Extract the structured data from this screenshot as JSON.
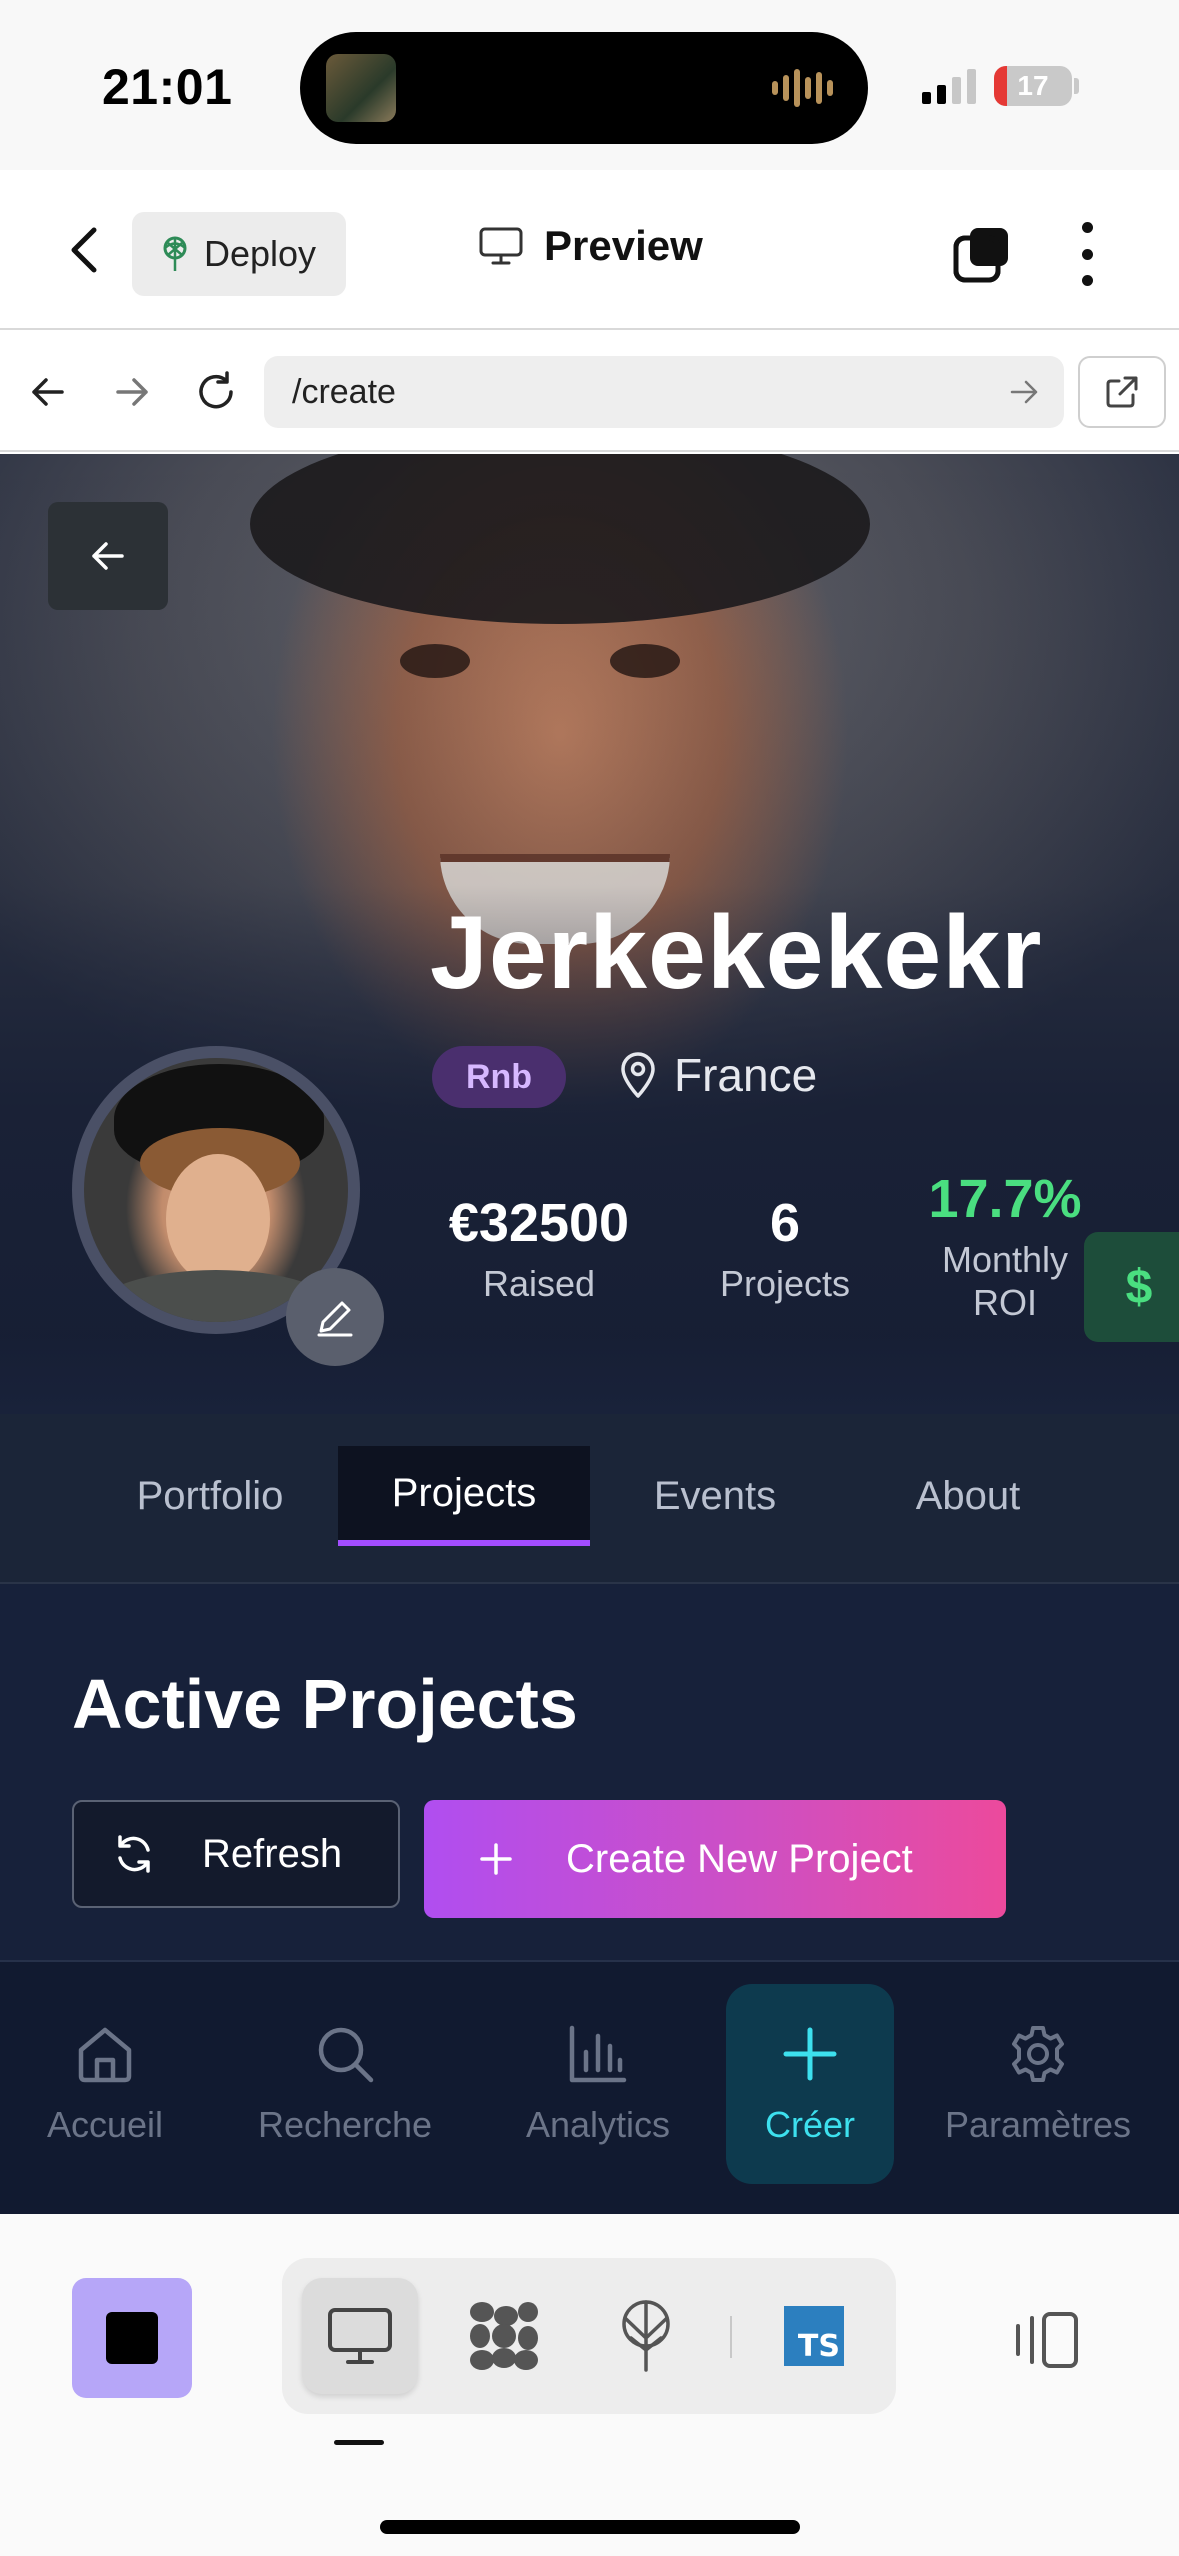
{
  "status_bar": {
    "time": "21:01",
    "battery": "17",
    "battery_level": 0.17
  },
  "header": {
    "deploy_label": "Deploy",
    "preview_label": "Preview"
  },
  "browser": {
    "url": "/create"
  },
  "profile": {
    "name": "Jerkekekekr",
    "tag": "Rnb",
    "location": "France",
    "stats": [
      {
        "value": "€32500",
        "label": "Raised"
      },
      {
        "value": "6",
        "label": "Projects"
      },
      {
        "value": "17.7%",
        "label": "Monthly ROI"
      }
    ],
    "action_symbol": "$"
  },
  "tabs": [
    {
      "label": "Portfolio",
      "active": false
    },
    {
      "label": "Projects",
      "active": true
    },
    {
      "label": "Events",
      "active": false
    },
    {
      "label": "About",
      "active": false
    }
  ],
  "section": {
    "title": "Active Projects",
    "refresh_label": "Refresh",
    "create_label": "Create New Project"
  },
  "bottom_nav": [
    {
      "label": "Accueil",
      "icon": "home-icon"
    },
    {
      "label": "Recherche",
      "icon": "search-icon"
    },
    {
      "label": "Analytics",
      "icon": "bar-chart-icon"
    },
    {
      "label": "Créer",
      "icon": "plus-icon",
      "active": true
    },
    {
      "label": "Paramètres",
      "icon": "gear-icon"
    }
  ],
  "editor_toolbar": {
    "ts_badge": "TS"
  },
  "colors": {
    "accent_purple": "#a34dff",
    "roi_green": "#4ade80",
    "create_gradient_start": "#b04ef0",
    "create_gradient_end": "#ec4a9c",
    "active_nav_cyan": "#3de0ee"
  }
}
